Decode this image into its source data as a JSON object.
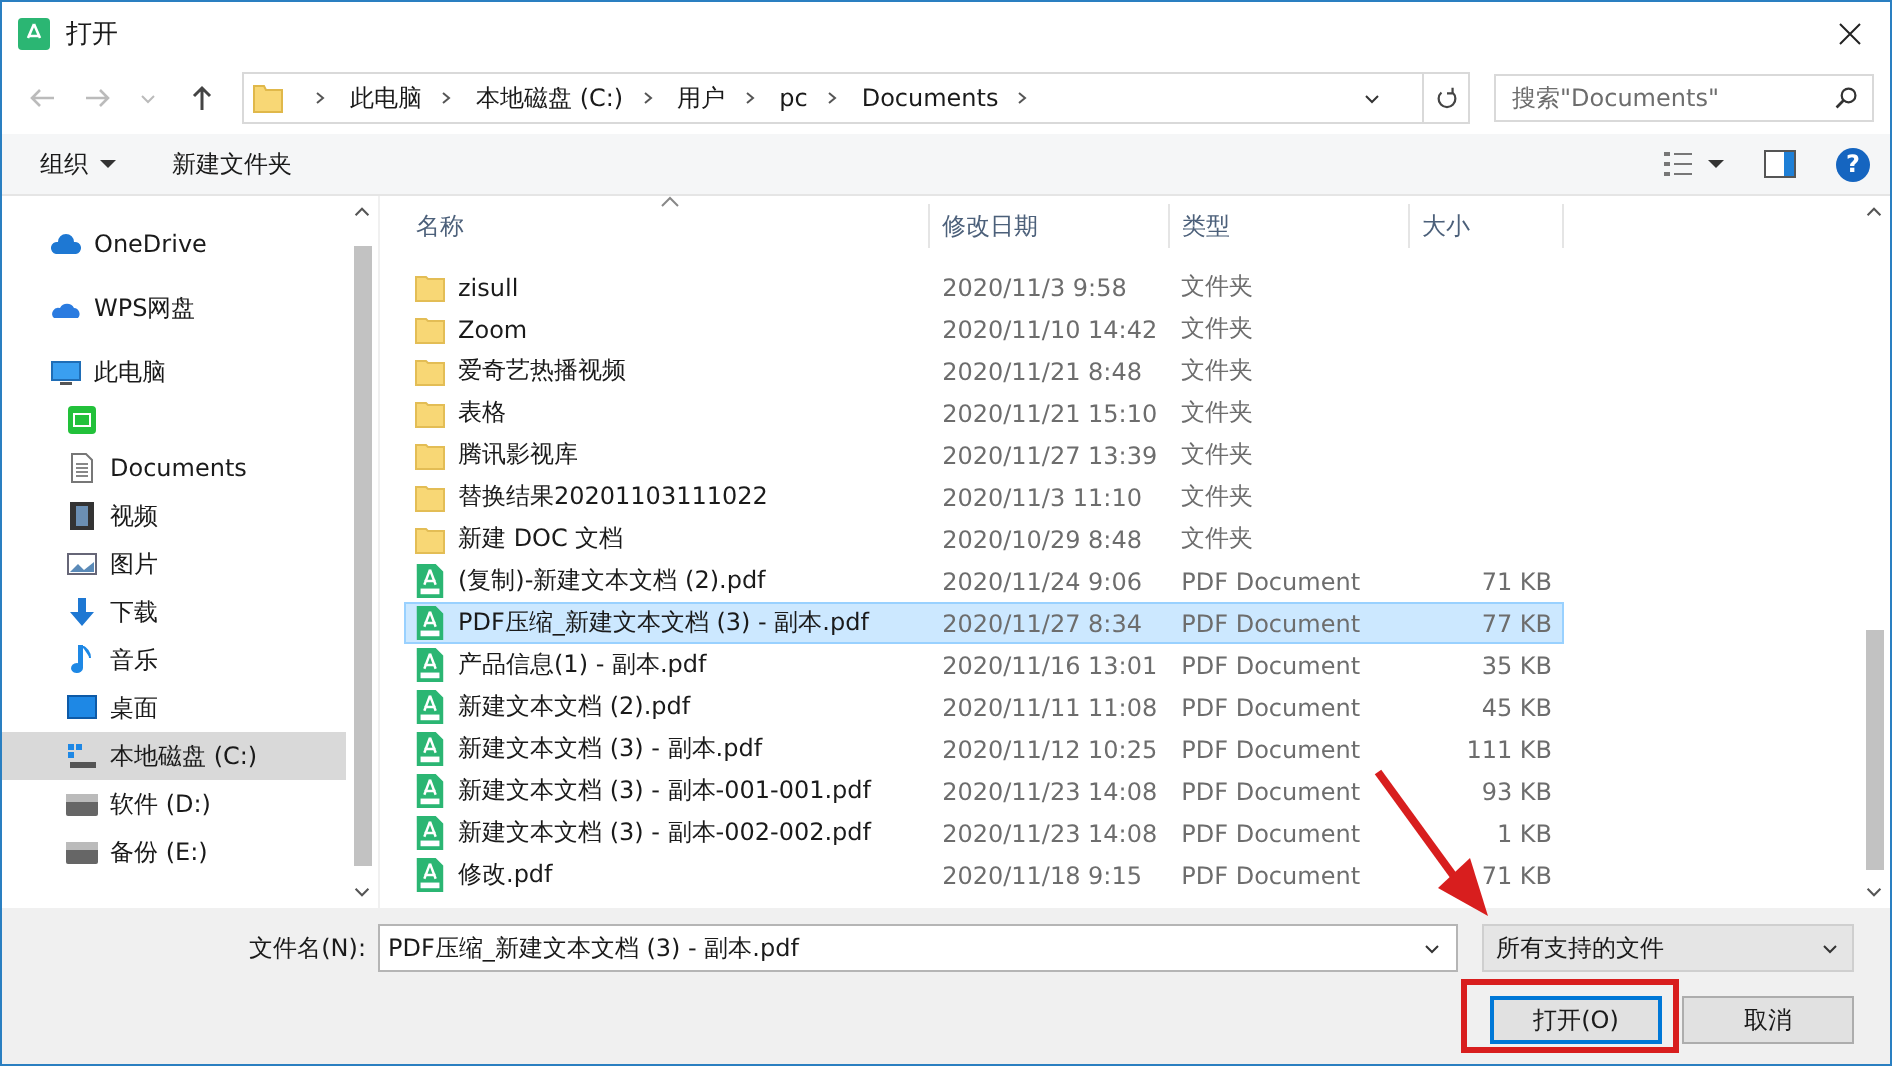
{
  "window": {
    "title": "打开"
  },
  "address_bar": {
    "segments": [
      "此电脑",
      "本地磁盘 (C:)",
      "用户",
      "pc",
      "Documents"
    ]
  },
  "search": {
    "placeholder": "搜索\"Documents\""
  },
  "toolbar": {
    "organize": "组织",
    "new_folder": "新建文件夹",
    "help": "?"
  },
  "sidebar": {
    "items": [
      {
        "label": "OneDrive",
        "kind": "cloud",
        "selected": false
      },
      {
        "label": "WPS网盘",
        "kind": "wps",
        "selected": false
      },
      {
        "label": "此电脑",
        "kind": "pc",
        "selected": false,
        "children": [
          {
            "kind": "app",
            "selected": false
          },
          {
            "label": "Documents",
            "kind": "doc",
            "selected": false
          },
          {
            "label": "视频",
            "kind": "video",
            "selected": false
          },
          {
            "label": "图片",
            "kind": "picture",
            "selected": false
          },
          {
            "label": "下载",
            "kind": "download",
            "selected": false
          },
          {
            "label": "音乐",
            "kind": "music",
            "selected": false
          },
          {
            "label": "桌面",
            "kind": "desktop",
            "selected": false
          },
          {
            "label": "本地磁盘 (C:)",
            "kind": "sysdrive",
            "selected": true
          },
          {
            "label": "软件 (D:)",
            "kind": "drive",
            "selected": false
          },
          {
            "label": "备份 (E:)",
            "kind": "drive",
            "selected": false
          }
        ]
      }
    ]
  },
  "table": {
    "columns": [
      "名称",
      "修改日期",
      "类型",
      "大小"
    ],
    "rows": [
      {
        "name": "zisull",
        "date": "2020/11/3 9:58",
        "type": "文件夹",
        "size": "",
        "kind": "folder",
        "selected": false
      },
      {
        "name": "Zoom",
        "date": "2020/11/10 14:42",
        "type": "文件夹",
        "size": "",
        "kind": "folder",
        "selected": false
      },
      {
        "name": "爱奇艺热播视频",
        "date": "2020/11/21 8:48",
        "type": "文件夹",
        "size": "",
        "kind": "folder",
        "selected": false
      },
      {
        "name": "表格",
        "date": "2020/11/21 15:10",
        "type": "文件夹",
        "size": "",
        "kind": "folder",
        "selected": false
      },
      {
        "name": "腾讯影视库",
        "date": "2020/11/27 13:39",
        "type": "文件夹",
        "size": "",
        "kind": "folder",
        "selected": false
      },
      {
        "name": "替换结果20201103111022",
        "date": "2020/11/3 11:10",
        "type": "文件夹",
        "size": "",
        "kind": "folder",
        "selected": false
      },
      {
        "name": "新建 DOC 文档",
        "date": "2020/10/29 8:48",
        "type": "文件夹",
        "size": "",
        "kind": "folder",
        "selected": false
      },
      {
        "name": "(复制)-新建文本文档 (2).pdf",
        "date": "2020/11/24 9:06",
        "type": "PDF Document",
        "size": "71 KB",
        "kind": "pdf",
        "selected": false
      },
      {
        "name": "PDF压缩_新建文本文档 (3) - 副本.pdf",
        "date": "2020/11/27 8:34",
        "type": "PDF Document",
        "size": "77 KB",
        "kind": "pdf",
        "selected": true
      },
      {
        "name": "产品信息(1) - 副本.pdf",
        "date": "2020/11/16 13:01",
        "type": "PDF Document",
        "size": "35 KB",
        "kind": "pdf",
        "selected": false
      },
      {
        "name": "新建文本文档 (2).pdf",
        "date": "2020/11/11 11:08",
        "type": "PDF Document",
        "size": "45 KB",
        "kind": "pdf",
        "selected": false
      },
      {
        "name": "新建文本文档 (3) - 副本.pdf",
        "date": "2020/11/12 10:25",
        "type": "PDF Document",
        "size": "111 KB",
        "kind": "pdf",
        "selected": false
      },
      {
        "name": "新建文本文档 (3) - 副本-001-001.pdf",
        "date": "2020/11/23 14:08",
        "type": "PDF Document",
        "size": "93 KB",
        "kind": "pdf",
        "selected": false
      },
      {
        "name": "新建文本文档 (3) - 副本-002-002.pdf",
        "date": "2020/11/23 14:08",
        "type": "PDF Document",
        "size": "1 KB",
        "kind": "pdf",
        "selected": false
      },
      {
        "name": "修改.pdf",
        "date": "2020/11/18 9:15",
        "type": "PDF Document",
        "size": "71 KB",
        "kind": "pdf",
        "selected": false
      }
    ]
  },
  "footer": {
    "filename_label": "文件名(N):",
    "filename": "PDF压缩_新建文本文档 (3) - 副本.pdf",
    "filter": "所有支持的文件",
    "open_button": "打开(O)",
    "cancel_button": "取消"
  }
}
